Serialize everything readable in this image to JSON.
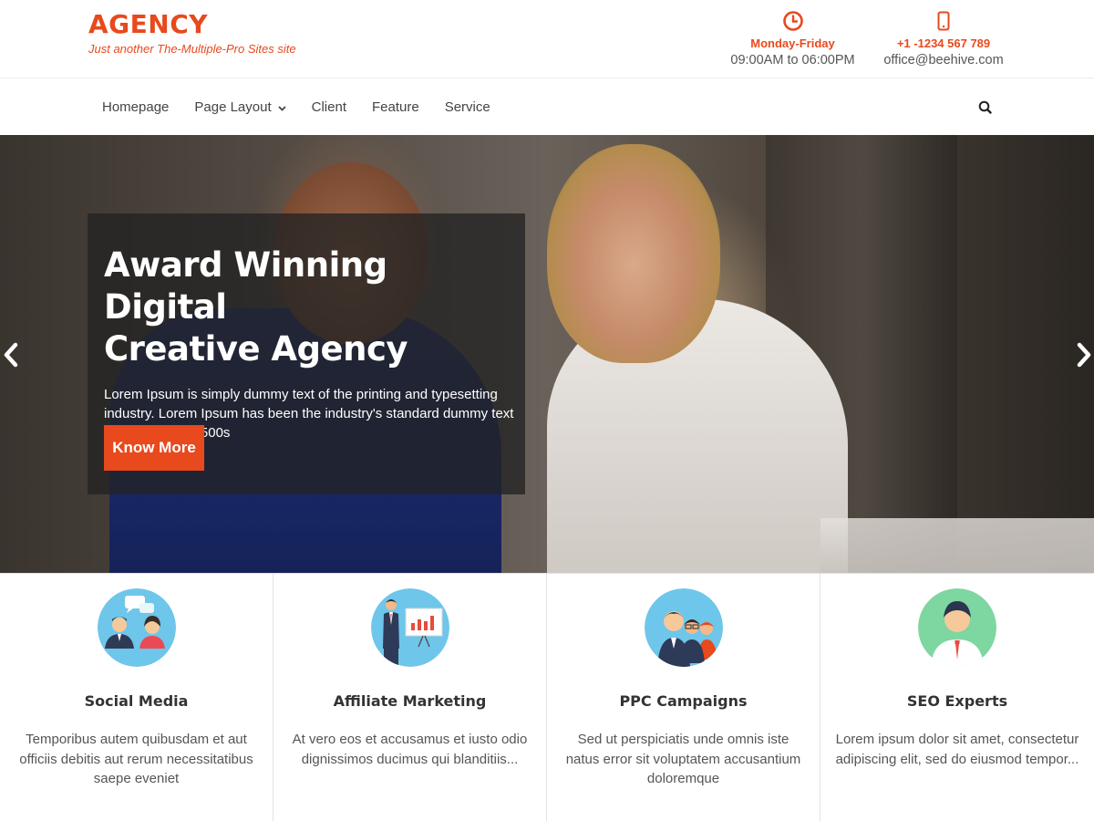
{
  "brand": {
    "title": "AGENCY",
    "tagline": "Just another The-Multiple-Pro Sites site"
  },
  "contact": {
    "hours_label": "Monday-Friday",
    "hours_value": "09:00AM to 06:00PM",
    "phone_label": "+1 -1234 567 789",
    "email_value": "office@beehive.com",
    "hours_icon": "clock-icon",
    "phone_icon": "mobile-phone-icon"
  },
  "nav": {
    "items": [
      {
        "label": "Homepage"
      },
      {
        "label": "Page Layout"
      },
      {
        "label": "Client"
      },
      {
        "label": "Feature"
      },
      {
        "label": "Service"
      }
    ],
    "search_icon": "search-icon"
  },
  "hero": {
    "title_line1": "Award Winning Digital",
    "title_line2": "Creative Agency",
    "text": "Lorem Ipsum is simply dummy text of the printing and typesetting industry. Lorem Ipsum has been the industry's standard dummy text ever since the 1500s",
    "button_label": "Know More"
  },
  "services": [
    {
      "title": "Social Media",
      "text": "Temporibus autem quibusdam et aut officiis debitis aut rerum necessitatibus saepe eveniet",
      "icon": "social-media-icon"
    },
    {
      "title": "Affiliate Marketing",
      "text": "At vero eos et accusamus et iusto odio dignissimos ducimus qui blanditiis...",
      "icon": "affiliate-marketing-icon"
    },
    {
      "title": "PPC Campaigns",
      "text": "Sed ut perspiciatis unde omnis iste natus error sit voluptatem accusantium doloremque",
      "icon": "ppc-campaigns-icon"
    },
    {
      "title": "SEO Experts",
      "text": "Lorem ipsum dolor sit amet, consectetur adipiscing elit, sed do eiusmod tempor...",
      "icon": "seo-experts-icon"
    }
  ],
  "colors": {
    "accent": "#e8491d",
    "icon_bg_blue": "#6ec6ea",
    "icon_bg_green": "#7ed6a0"
  }
}
